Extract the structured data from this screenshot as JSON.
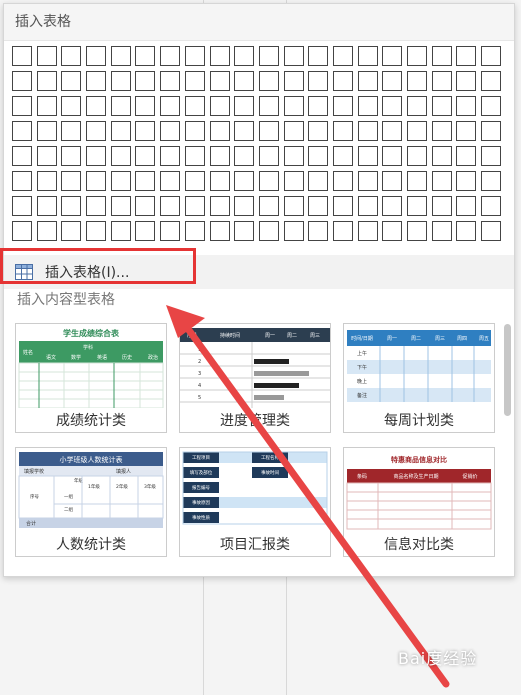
{
  "panel": {
    "title": "插入表格",
    "insert_label": "插入表格(I)...",
    "section_label": "插入内容型表格"
  },
  "templates": [
    {
      "caption": "成绩统计类",
      "title": "学生成绩综合表",
      "sub": "学科",
      "name_col": "姓名",
      "cols": [
        "语文",
        "数学",
        "英语",
        "历史",
        "政治"
      ]
    },
    {
      "caption": "进度管理类",
      "cols": [
        "序号",
        "持续时间",
        "周一",
        "周二",
        "周三"
      ],
      "rows": [
        "1",
        "2",
        "3",
        "4",
        "5"
      ]
    },
    {
      "caption": "每周计划类",
      "cols": [
        "时间/日期",
        "周一",
        "周二",
        "周三",
        "周四",
        "周五"
      ],
      "rows": [
        "上午",
        "下午",
        "晚上",
        "备注"
      ]
    },
    {
      "caption": "人数统计类",
      "title": "小学班级人数统计表",
      "labels": [
        "填报学校",
        "填报人",
        "年级",
        "序号",
        "1年级",
        "2年级",
        "3年级",
        "一组",
        "二组",
        "合计"
      ]
    },
    {
      "caption": "项目汇报类",
      "labels": [
        "工程项目",
        "工程名称",
        "填写及部位",
        "事故时间",
        "报告编号",
        "事故原因",
        "事故性质"
      ]
    },
    {
      "caption": "信息对比类",
      "title": "特惠商品信息对比",
      "cols": [
        "条码",
        "商品名称及生产日期",
        "促销价"
      ]
    }
  ],
  "watermark": "Bai度经验"
}
